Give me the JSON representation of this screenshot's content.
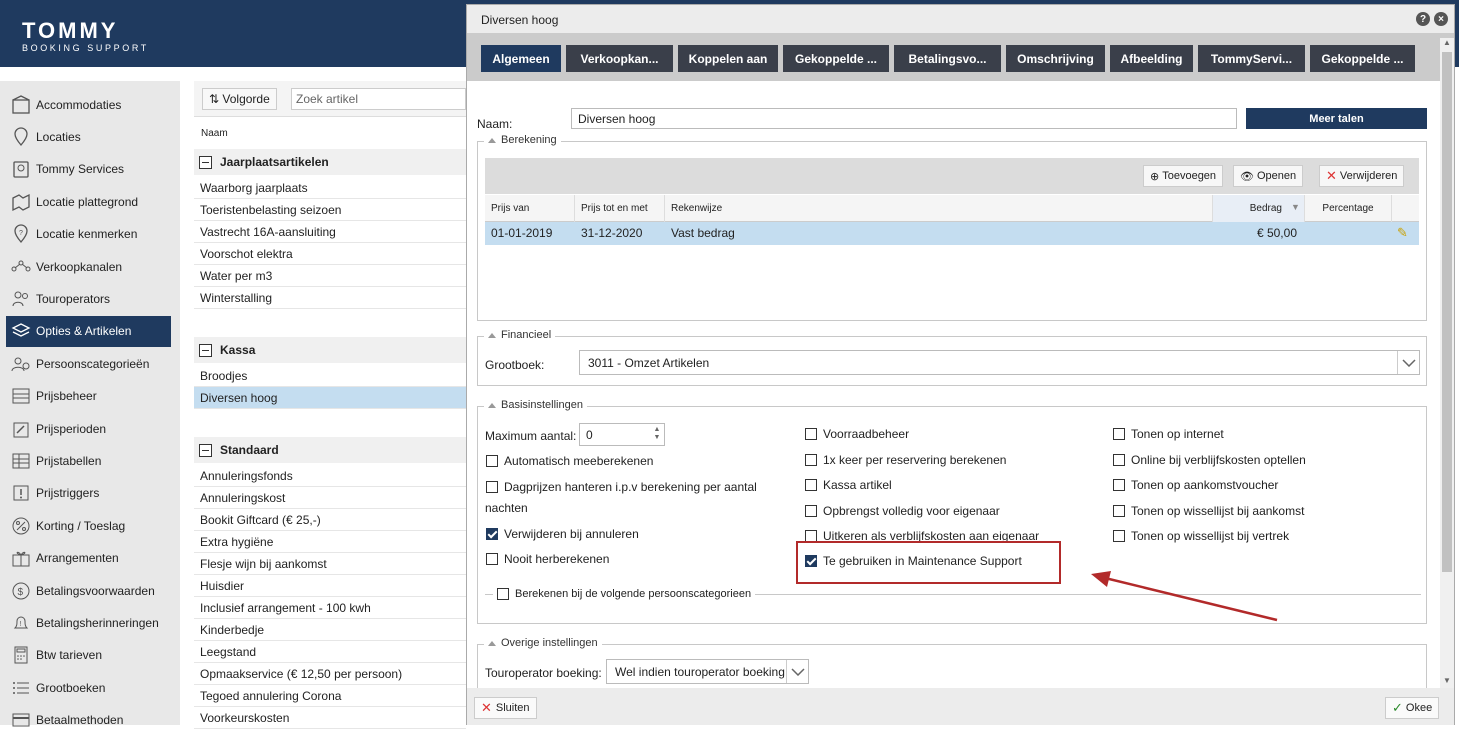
{
  "brand": {
    "name": "TOMMY",
    "tagline": "BOOKING SUPPORT"
  },
  "sidebar": {
    "items": [
      {
        "label": "Accommodaties",
        "icon": "building-icon"
      },
      {
        "label": "Locaties",
        "icon": "map-pin-icon"
      },
      {
        "label": "Tommy Services",
        "icon": "service-icon"
      },
      {
        "label": "Locatie plattegrond",
        "icon": "floorplan-icon"
      },
      {
        "label": "Locatie kenmerken",
        "icon": "location-feature-icon"
      },
      {
        "label": "Verkoopkanalen",
        "icon": "network-icon"
      },
      {
        "label": "Touroperators",
        "icon": "people-icon"
      },
      {
        "label": "Opties & Artikelen",
        "icon": "layers-icon",
        "active": true
      },
      {
        "label": "Persoonscategorieën",
        "icon": "person-gear-icon"
      },
      {
        "label": "Prijsbeheer",
        "icon": "abacus-icon"
      },
      {
        "label": "Prijsperioden",
        "icon": "calendar-edit-icon"
      },
      {
        "label": "Prijstabellen",
        "icon": "table-icon"
      },
      {
        "label": "Prijstriggers",
        "icon": "exclamation-icon"
      },
      {
        "label": "Korting / Toeslag",
        "icon": "percent-icon"
      },
      {
        "label": "Arrangementen",
        "icon": "gift-icon"
      },
      {
        "label": "Betalingsvoorwaarden",
        "icon": "dollar-icon"
      },
      {
        "label": "Betalingsherinneringen",
        "icon": "bell-icon"
      },
      {
        "label": "Btw tarieven",
        "icon": "calculator-icon"
      },
      {
        "label": "Grootboeken",
        "icon": "list-icon"
      },
      {
        "label": "Betaalmethoden",
        "icon": "card-icon"
      }
    ]
  },
  "list": {
    "sort_label": "Volgorde",
    "search_placeholder": "Zoek artikel",
    "column_name": "Naam",
    "groups": [
      {
        "title": "Jaarplaatsartikelen",
        "items": [
          "Waarborg jaarplaats",
          "Toeristenbelasting seizoen",
          "Vastrecht 16A-aansluiting",
          "Voorschot elektra",
          "Water per m3",
          "Winterstalling"
        ]
      },
      {
        "title": "Kassa",
        "items": [
          "Broodjes",
          "Diversen hoog"
        ]
      },
      {
        "title": "Standaard",
        "items": [
          "Annuleringsfonds",
          "Annuleringskost",
          "Bookit Giftcard (€ 25,-)",
          "Extra hygiëne",
          "Flesje wijn bij aankomst",
          "Huisdier",
          "Inclusief arrangement - 100 kwh",
          "Kinderbedje",
          "Leegstand",
          "Opmaakservice (€ 12,50 per persoon)",
          "Tegoed annulering Corona",
          "Voorkeurskosten"
        ]
      }
    ],
    "selected_item": "Diversen hoog"
  },
  "dialog": {
    "title": "Diversen hoog",
    "tabs": [
      "Algemeen",
      "Verkoopkan...",
      "Koppelen aan",
      "Gekoppelde ...",
      "Betalingsvo...",
      "Omschrijving",
      "Afbeelding",
      "TommyServi...",
      "Gekoppelde ..."
    ],
    "name_label": "Naam:",
    "name_value": "Diversen hoog",
    "meer_talen": "Meer talen",
    "berekening": {
      "legend": "Berekening",
      "btn_add": "Toevoegen",
      "btn_open": "Openen",
      "btn_delete": "Verwijderen",
      "columns": [
        "Prijs van",
        "Prijs tot en met",
        "Rekenwijze",
        "Bedrag",
        "Percentage"
      ],
      "rows": [
        {
          "van": "01-01-2019",
          "tot": "31-12-2020",
          "rekenwijze": "Vast bedrag",
          "bedrag": "€ 50,00",
          "percentage": ""
        }
      ]
    },
    "financieel": {
      "legend": "Financieel",
      "grootboek_label": "Grootboek:",
      "grootboek_value": "3011 - Omzet Artikelen"
    },
    "basis": {
      "legend": "Basisinstellingen",
      "max_label": "Maximum aantal:",
      "max_value": "0",
      "col1": [
        {
          "label": "Automatisch meeberekenen",
          "checked": false
        },
        {
          "label": "Dagprijzen hanteren i.p.v berekening per aantal",
          "label2": "nachten",
          "checked": false
        },
        {
          "label": "Verwijderen bij annuleren",
          "checked": true
        },
        {
          "label": "Nooit herberekenen",
          "checked": false
        }
      ],
      "col2": [
        {
          "label": "Voorraadbeheer",
          "checked": false
        },
        {
          "label": "1x keer per reservering berekenen",
          "checked": false
        },
        {
          "label": "Kassa artikel",
          "checked": false
        },
        {
          "label": "Opbrengst volledig voor eigenaar",
          "checked": false
        },
        {
          "label": "Uitkeren als verblijfskosten aan eigenaar",
          "checked": false
        },
        {
          "label": "Te gebruiken in Maintenance Support",
          "checked": true
        }
      ],
      "col3": [
        {
          "label": "Tonen op internet",
          "checked": false
        },
        {
          "label": "Online bij verblijfskosten optellen",
          "checked": false
        },
        {
          "label": "Tonen op aankomstvoucher",
          "checked": false
        },
        {
          "label": "Tonen op wissellijst bij aankomst",
          "checked": false
        },
        {
          "label": "Tonen op wissellijst bij vertrek",
          "checked": false
        }
      ],
      "persoons_label": "Berekenen bij de volgende persoonscategorieen"
    },
    "overige": {
      "legend": "Overige instellingen",
      "touroperator_label": "Touroperator boeking:",
      "touroperator_value": "Wel indien touroperator boeking"
    },
    "footer": {
      "close": "Sluiten",
      "ok": "Okee"
    }
  },
  "colors": {
    "navy": "#1f3a5f",
    "highlight": "#b22a2a",
    "selection": "#c4ddf0"
  }
}
